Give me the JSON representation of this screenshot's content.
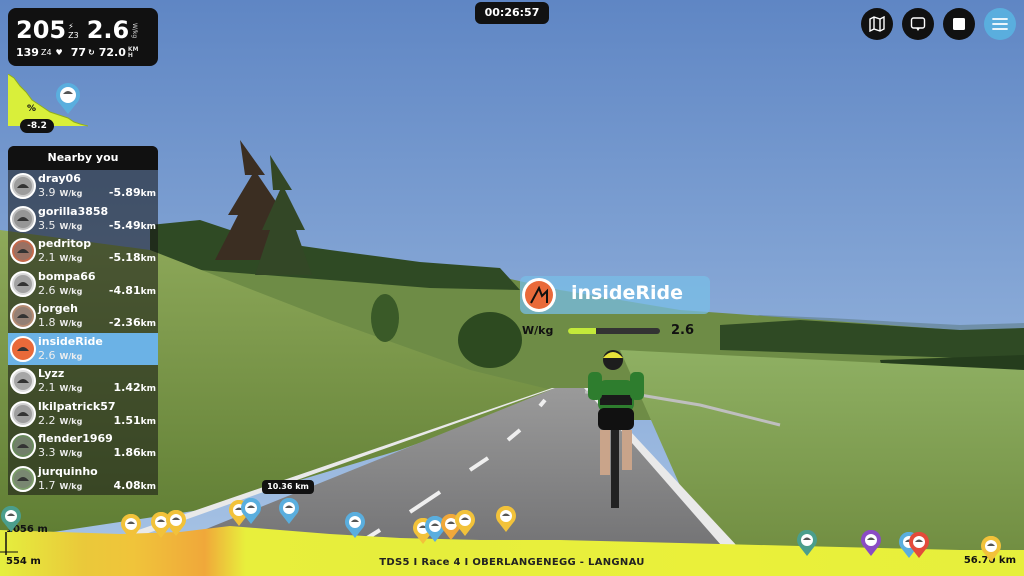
{
  "stats": {
    "power": "205",
    "power_zone": "Z3",
    "wkg": "2.6",
    "wkg_unit": "W/kg",
    "hr": "139",
    "hr_zone": "Z4",
    "cadence": "77",
    "speed": "72.0",
    "speed_unit_top": "KM",
    "speed_unit_bot": "H"
  },
  "gradient": {
    "symbol": "%",
    "value": "-8.2"
  },
  "timer": "00:26:57",
  "top_buttons": [
    {
      "name": "map-button",
      "icon": "map-icon"
    },
    {
      "name": "view-button",
      "icon": "camera-rotate-icon"
    },
    {
      "name": "stop-button",
      "icon": "stop-icon"
    },
    {
      "name": "menu-button",
      "icon": "hamburger-icon"
    }
  ],
  "nearby": {
    "title": "Nearby you",
    "wkg_unit": "W/kg",
    "dist_unit": "km",
    "riders": [
      {
        "name": "dray06",
        "wkg": "3.9",
        "dist": "-5.89",
        "me": false,
        "avatar_color": "#c9c9c9"
      },
      {
        "name": "gorilla3858",
        "wkg": "3.5",
        "dist": "-5.49",
        "me": false,
        "avatar_color": "#bdbdbd"
      },
      {
        "name": "pedritop",
        "wkg": "2.1",
        "dist": "-5.18",
        "me": false,
        "avatar_color": "#c46a4c"
      },
      {
        "name": "bompa66",
        "wkg": "2.6",
        "dist": "-4.81",
        "me": false,
        "avatar_color": "#d8d8d8"
      },
      {
        "name": "jorgeh",
        "wkg": "1.8",
        "dist": "-2.36",
        "me": false,
        "avatar_color": "#b58b72"
      },
      {
        "name": "insideRide",
        "wkg": "2.6",
        "dist": "",
        "me": true,
        "avatar_color": "#e96a3a"
      },
      {
        "name": "Lyzz",
        "wkg": "2.1",
        "dist": "1.42",
        "me": false,
        "avatar_color": "#e0e0e0"
      },
      {
        "name": "lkilpatrick57",
        "wkg": "2.2",
        "dist": "1.51",
        "me": false,
        "avatar_color": "#cfcfcf"
      },
      {
        "name": "flender1969",
        "wkg": "3.3",
        "dist": "1.86",
        "me": false,
        "avatar_color": "#6a8b5c"
      },
      {
        "name": "jurquinho",
        "wkg": "1.7",
        "dist": "4.08",
        "me": false,
        "avatar_color": "#7c9c6a"
      }
    ]
  },
  "rider_label": {
    "name": "insideRide",
    "wkg_label": "W/kg",
    "wkg_value": "2.6",
    "wkg_fraction": 0.3
  },
  "distance_tag": "10.36 km",
  "profile": {
    "elev_top": "1056 m",
    "elev_bottom": "554 m",
    "route_name": "TDS5 I Race 4 I OBERLANGENEGG - LANGNAU",
    "route_distance": "56.70 km"
  },
  "colors": {
    "panel": "#111111",
    "accent_blue": "#5aaede",
    "highlight_row": "#6bb2e6",
    "lime": "#c3ea3a",
    "profile_yellow": "#e8ef3c",
    "profile_orange": "#f0a83a"
  }
}
